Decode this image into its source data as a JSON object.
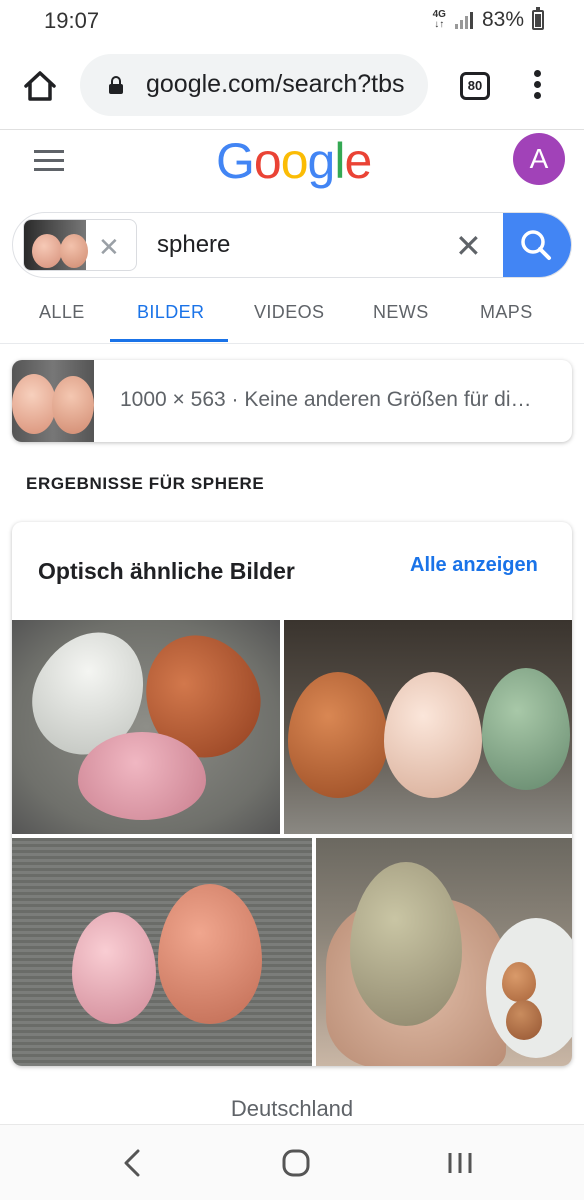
{
  "status_bar": {
    "time": "19:07",
    "network": "4G",
    "battery": "83%"
  },
  "browser": {
    "url": "google.com/search?tbs",
    "tab_count": "80"
  },
  "google": {
    "logo_letters": [
      "G",
      "o",
      "o",
      "g",
      "l",
      "e"
    ],
    "logo_colors": [
      "#4285f4",
      "#ea4335",
      "#fbbc05",
      "#4285f4",
      "#34a853",
      "#ea4335"
    ],
    "avatar_letter": "A",
    "avatar_color": "#a142b8"
  },
  "search": {
    "query": "sphere"
  },
  "tabs": [
    {
      "label": "ALLE",
      "active": false
    },
    {
      "label": "BILDER",
      "active": true
    },
    {
      "label": "VIDEOS",
      "active": false
    },
    {
      "label": "NEWS",
      "active": false
    },
    {
      "label": "MAPS",
      "active": false
    }
  ],
  "image_info": {
    "text": "1000 × 563 · Keine anderen Größen für di…"
  },
  "results_heading": "ERGEBNISSE FÜR SPHERE",
  "similar": {
    "title": "Optisch ähnliche Bilder",
    "link": "Alle anzeigen"
  },
  "footer": {
    "country": "Deutschland"
  },
  "colors": {
    "accent": "#1a73e8",
    "search_button": "#4285f4"
  }
}
